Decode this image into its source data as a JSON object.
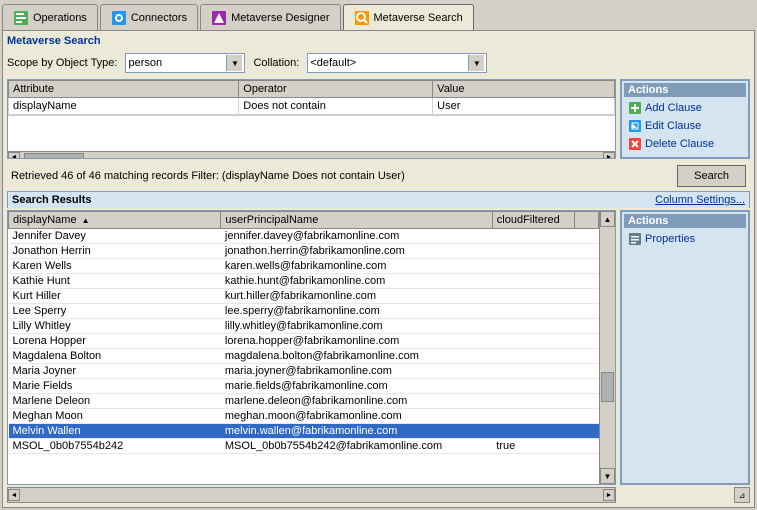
{
  "tabs": [
    {
      "id": "operations",
      "label": "Operations",
      "active": false
    },
    {
      "id": "connectors",
      "label": "Connectors",
      "active": false
    },
    {
      "id": "metaverse-designer",
      "label": "Metaverse Designer",
      "active": false
    },
    {
      "id": "metaverse-search",
      "label": "Metaverse Search",
      "active": true
    }
  ],
  "section_title": "Metaverse Search",
  "scope": {
    "label": "Scope by Object Type:",
    "object_type": "person",
    "collation_label": "Collation:",
    "collation_value": "<default>"
  },
  "filter_table": {
    "columns": [
      "Attribute",
      "Operator",
      "Value"
    ],
    "rows": [
      {
        "attribute": "displayName",
        "operator": "Does not contain",
        "value": "User"
      }
    ]
  },
  "actions_top": {
    "title": "Actions",
    "items": [
      "Add Clause",
      "Edit Clause",
      "Delete Clause"
    ]
  },
  "status": {
    "text": "Retrieved 46 of 46 matching records   Filter: (displayName Does not contain User)"
  },
  "search_button_label": "Search",
  "results": {
    "title": "Search Results",
    "column_settings_label": "Column Settings...",
    "columns": [
      "displayName",
      "userPrincipalName",
      "cloudFiltered"
    ],
    "rows": [
      {
        "displayName": "Jennifer Davey",
        "userPrincipalName": "jennifer.davey@fabrikamonline.com",
        "cloudFiltered": "",
        "selected": false
      },
      {
        "displayName": "Jonathon Herrin",
        "userPrincipalName": "jonathon.herrin@fabrikamonline.com",
        "cloudFiltered": "",
        "selected": false
      },
      {
        "displayName": "Karen Wells",
        "userPrincipalName": "karen.wells@fabrikamonline.com",
        "cloudFiltered": "",
        "selected": false
      },
      {
        "displayName": "Kathie Hunt",
        "userPrincipalName": "kathie.hunt@fabrikamonline.com",
        "cloudFiltered": "",
        "selected": false
      },
      {
        "displayName": "Kurt Hiller",
        "userPrincipalName": "kurt.hiller@fabrikamonline.com",
        "cloudFiltered": "",
        "selected": false
      },
      {
        "displayName": "Lee Sperry",
        "userPrincipalName": "lee.sperry@fabrikamonline.com",
        "cloudFiltered": "",
        "selected": false
      },
      {
        "displayName": "Lilly Whitley",
        "userPrincipalName": "lilly.whitley@fabrikamonline.com",
        "cloudFiltered": "",
        "selected": false
      },
      {
        "displayName": "Lorena Hopper",
        "userPrincipalName": "lorena.hopper@fabrikamonline.com",
        "cloudFiltered": "",
        "selected": false
      },
      {
        "displayName": "Magdalena Bolton",
        "userPrincipalName": "magdalena.bolton@fabrikamonline.com",
        "cloudFiltered": "",
        "selected": false
      },
      {
        "displayName": "Maria Joyner",
        "userPrincipalName": "maria.joyner@fabrikamonline.com",
        "cloudFiltered": "",
        "selected": false
      },
      {
        "displayName": "Marie Fields",
        "userPrincipalName": "marie.fields@fabrikamonline.com",
        "cloudFiltered": "",
        "selected": false
      },
      {
        "displayName": "Marlene Deleon",
        "userPrincipalName": "marlene.deleon@fabrikamonline.com",
        "cloudFiltered": "",
        "selected": false
      },
      {
        "displayName": "Meghan Moon",
        "userPrincipalName": "meghan.moon@fabrikamonline.com",
        "cloudFiltered": "",
        "selected": false
      },
      {
        "displayName": "Melvin Wallen",
        "userPrincipalName": "melvin.wallen@fabrikamonline.com",
        "cloudFiltered": "",
        "selected": true
      },
      {
        "displayName": "MSOL_0b0b7554b242",
        "userPrincipalName": "MSOL_0b0b7554b242@fabrikamonline.com",
        "cloudFiltered": "true",
        "selected": false
      }
    ]
  },
  "actions_bottom": {
    "title": "Actions",
    "items": [
      "Properties"
    ]
  }
}
